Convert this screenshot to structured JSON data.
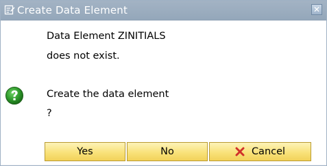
{
  "window": {
    "title": "Create Data Element",
    "close_symbol": "✕"
  },
  "message": {
    "line1": "Data Element ZINITIALS",
    "line2": "does not exist.",
    "line3": "Create the data element",
    "line4": "?"
  },
  "icons": {
    "title": "dialog-window-icon",
    "question": "question-mark-icon",
    "cancel": "red-x-icon"
  },
  "buttons": {
    "yes": "Yes",
    "no": "No",
    "cancel": "Cancel"
  },
  "colors": {
    "titlebar": "#9aabbd",
    "button_face": "#f9e27a",
    "question_icon": "#2f9a2b",
    "cancel_icon": "#d0302a"
  }
}
